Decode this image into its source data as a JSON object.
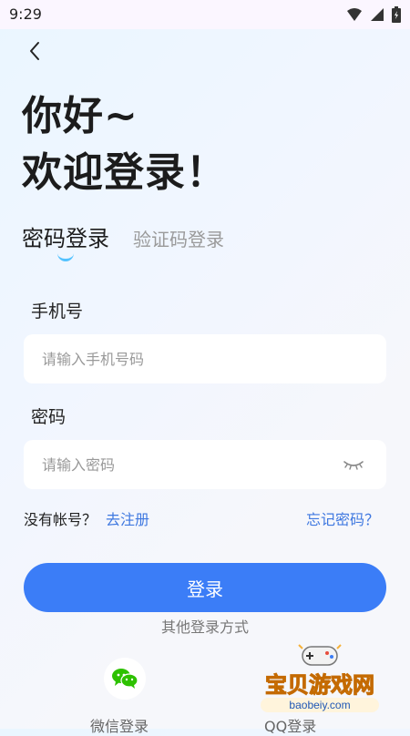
{
  "status_bar": {
    "time": "9:29",
    "icons": [
      "wifi-icon",
      "signal-icon",
      "battery-icon"
    ]
  },
  "header": {
    "back_icon": "chevron-left-icon"
  },
  "greeting": {
    "line1": "你好~",
    "line2": "欢迎登录！"
  },
  "tabs": [
    {
      "label": "密码登录",
      "active": true
    },
    {
      "label": "验证码登录",
      "active": false
    }
  ],
  "form": {
    "phone": {
      "label": "手机号",
      "placeholder": "请输入手机号码",
      "value": ""
    },
    "password": {
      "label": "密码",
      "placeholder": "请输入密码",
      "value": "",
      "toggle_icon": "eye-closed-icon"
    }
  },
  "links": {
    "no_account": "没有帐号？",
    "register": "去注册",
    "forgot": "忘记密码？"
  },
  "login_button": {
    "label": "登录"
  },
  "other_login": {
    "title": "其他登录方式",
    "wechat_label": "微信登录",
    "qq_label": "QQ登录"
  },
  "watermark": {
    "title": "宝贝游戏网",
    "url": "baobeiy.com"
  },
  "colors": {
    "accent": "#3b7df7",
    "link": "#3f78e0",
    "indicator": "#53c2ff",
    "wechat": "#2dc100"
  }
}
